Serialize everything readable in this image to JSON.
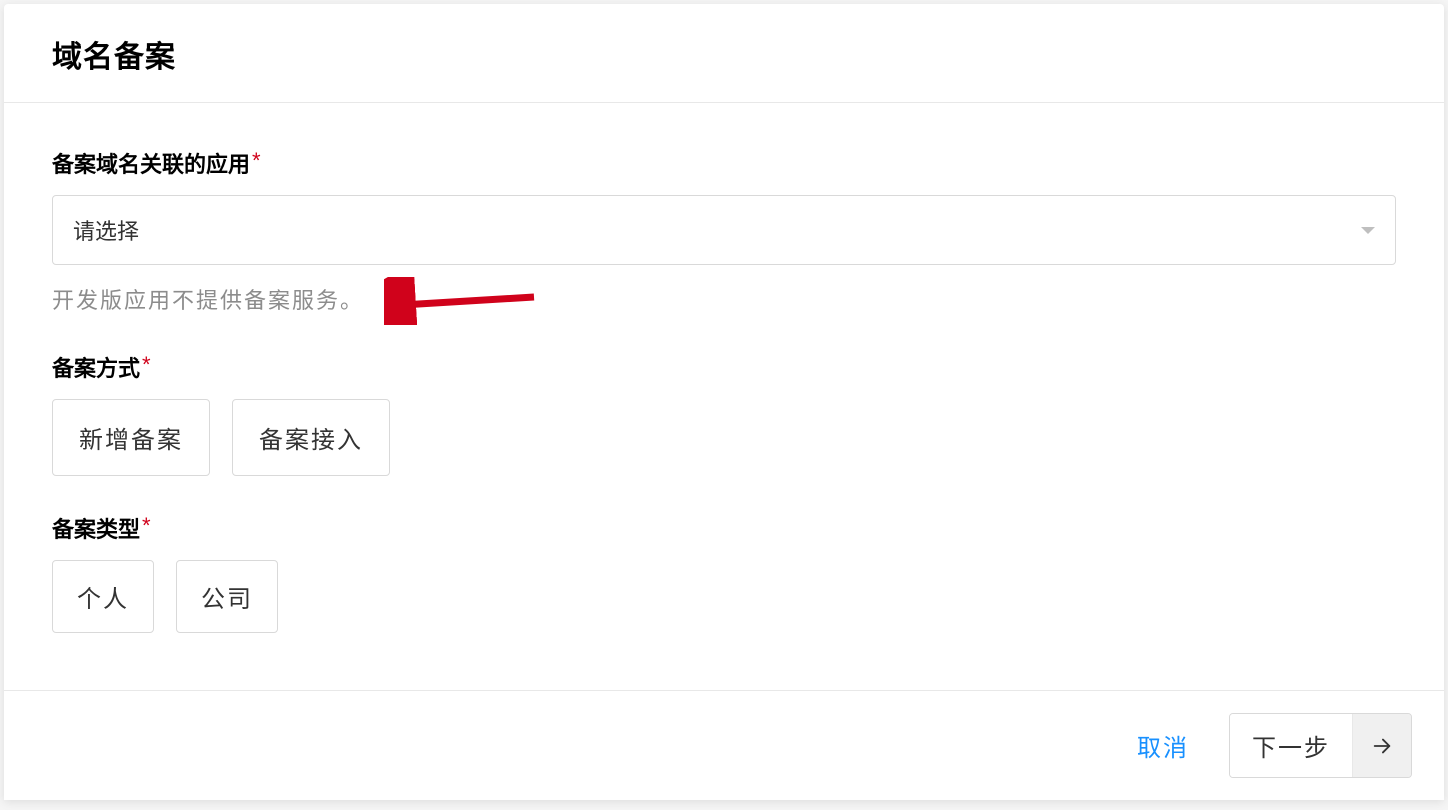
{
  "modal": {
    "title": "域名备案",
    "footer": {
      "cancel": "取消",
      "next": "下一步"
    }
  },
  "form": {
    "app": {
      "label": "备案域名关联的应用",
      "placeholder": "请选择",
      "helper": "开发版应用不提供备案服务。"
    },
    "method": {
      "label": "备案方式",
      "options": [
        "新增备案",
        "备案接入"
      ]
    },
    "type": {
      "label": "备案类型",
      "options": [
        "个人",
        "公司"
      ]
    }
  }
}
